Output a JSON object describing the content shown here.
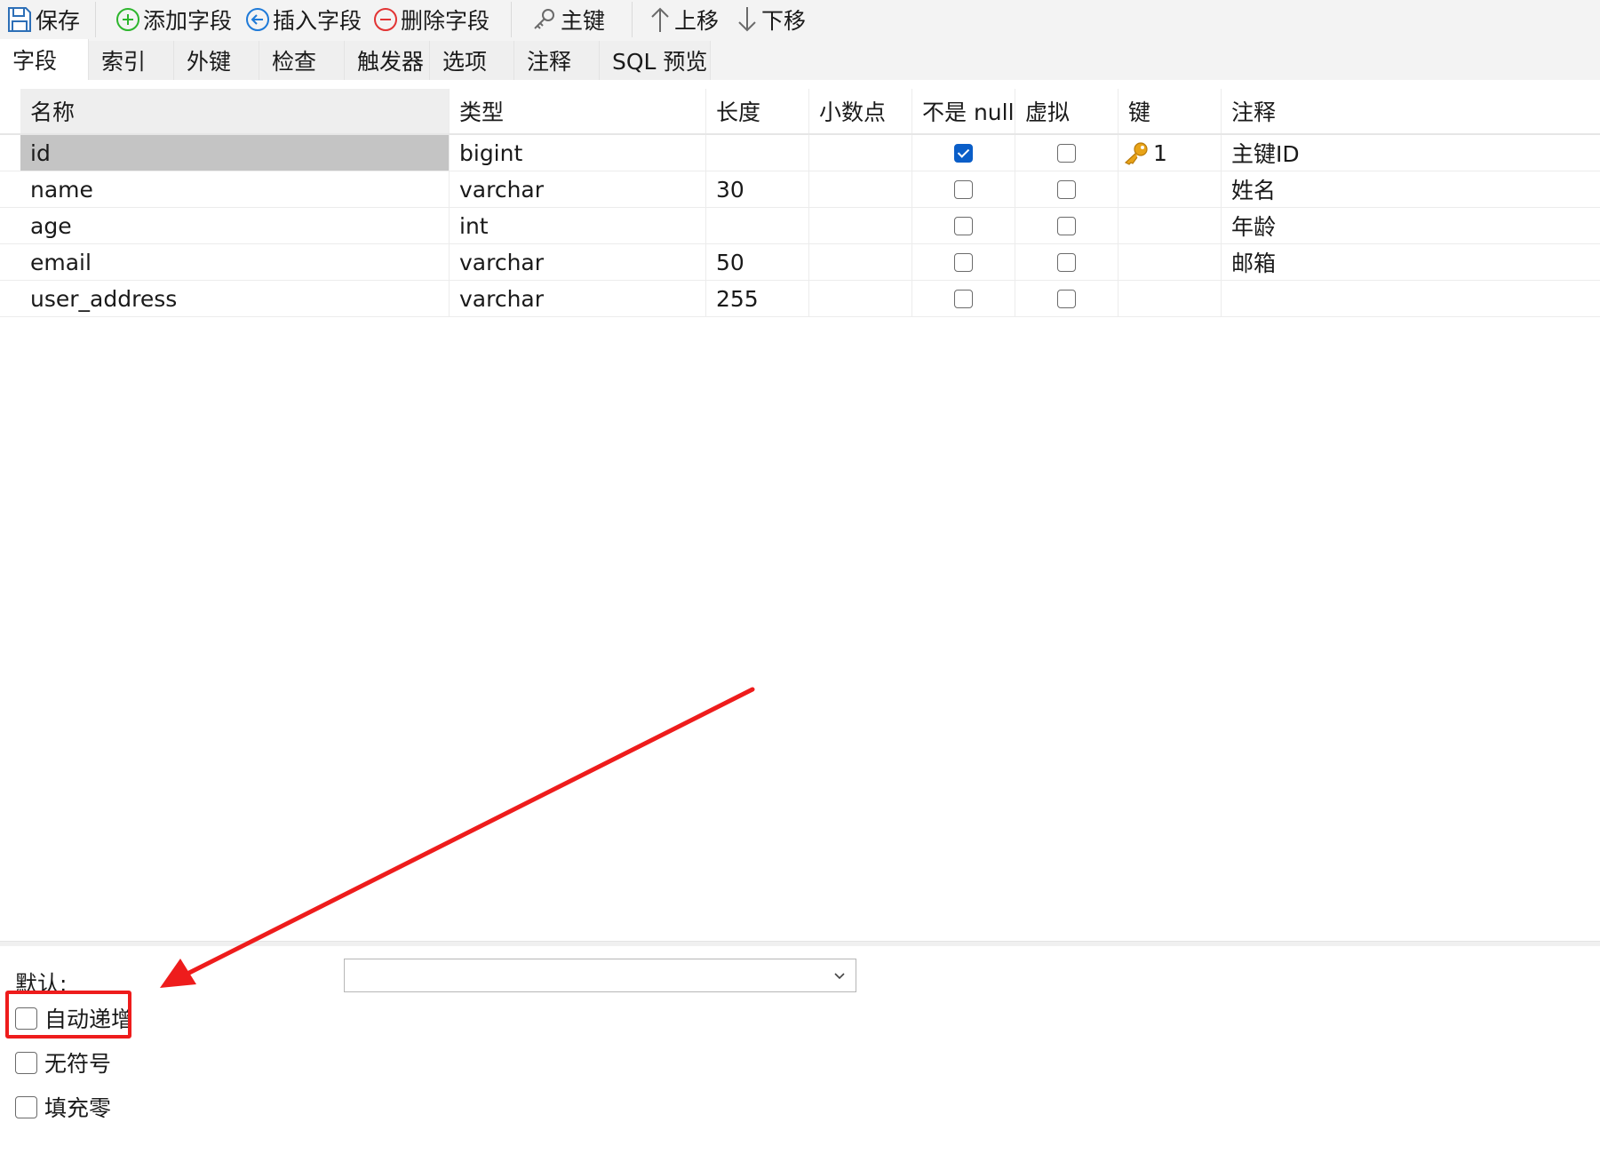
{
  "toolbar": {
    "save": "保存",
    "add_field": "添加字段",
    "insert_field": "插入字段",
    "delete_field": "删除字段",
    "primary_key": "主键",
    "move_up": "上移",
    "move_down": "下移"
  },
  "tabs": [
    {
      "label": "字段",
      "active": true
    },
    {
      "label": "索引"
    },
    {
      "label": "外键"
    },
    {
      "label": "检查"
    },
    {
      "label": "触发器"
    },
    {
      "label": "选项"
    },
    {
      "label": "注释"
    },
    {
      "label": "SQL 预览"
    }
  ],
  "grid": {
    "columns": [
      "名称",
      "类型",
      "长度",
      "小数点",
      "不是 null",
      "虚拟",
      "键",
      "注释"
    ],
    "rows": [
      {
        "name": "id",
        "type": "bigint",
        "length": "",
        "decimals": "",
        "not_null": true,
        "virtual": false,
        "key": "1",
        "comment": "主键ID"
      },
      {
        "name": "name",
        "type": "varchar",
        "length": "30",
        "decimals": "",
        "not_null": false,
        "virtual": false,
        "key": "",
        "comment": "姓名"
      },
      {
        "name": "age",
        "type": "int",
        "length": "",
        "decimals": "",
        "not_null": false,
        "virtual": false,
        "key": "",
        "comment": "年龄"
      },
      {
        "name": "email",
        "type": "varchar",
        "length": "50",
        "decimals": "",
        "not_null": false,
        "virtual": false,
        "key": "",
        "comment": "邮箱"
      },
      {
        "name": "user_address",
        "type": "varchar",
        "length": "255",
        "decimals": "",
        "not_null": false,
        "virtual": false,
        "key": "",
        "comment": ""
      }
    ]
  },
  "properties": {
    "default_label": "默认:",
    "default_value": "",
    "options": [
      {
        "label": "自动递增",
        "checked": false
      },
      {
        "label": "无符号",
        "checked": false
      },
      {
        "label": "填充零",
        "checked": false
      }
    ]
  },
  "colors": {
    "check_blue": "#0a5ec8",
    "annotation_red": "#ee1c1c",
    "key_gold": "#e8a317",
    "add_green": "#2db52d",
    "insert_blue": "#1e7ad8",
    "delete_red": "#e23434"
  },
  "icons": [
    "save-icon",
    "add-circle-icon",
    "insert-arrow-icon",
    "delete-circle-icon",
    "key-icon",
    "arrow-up-icon",
    "arrow-down-icon",
    "chevron-down-icon"
  ]
}
